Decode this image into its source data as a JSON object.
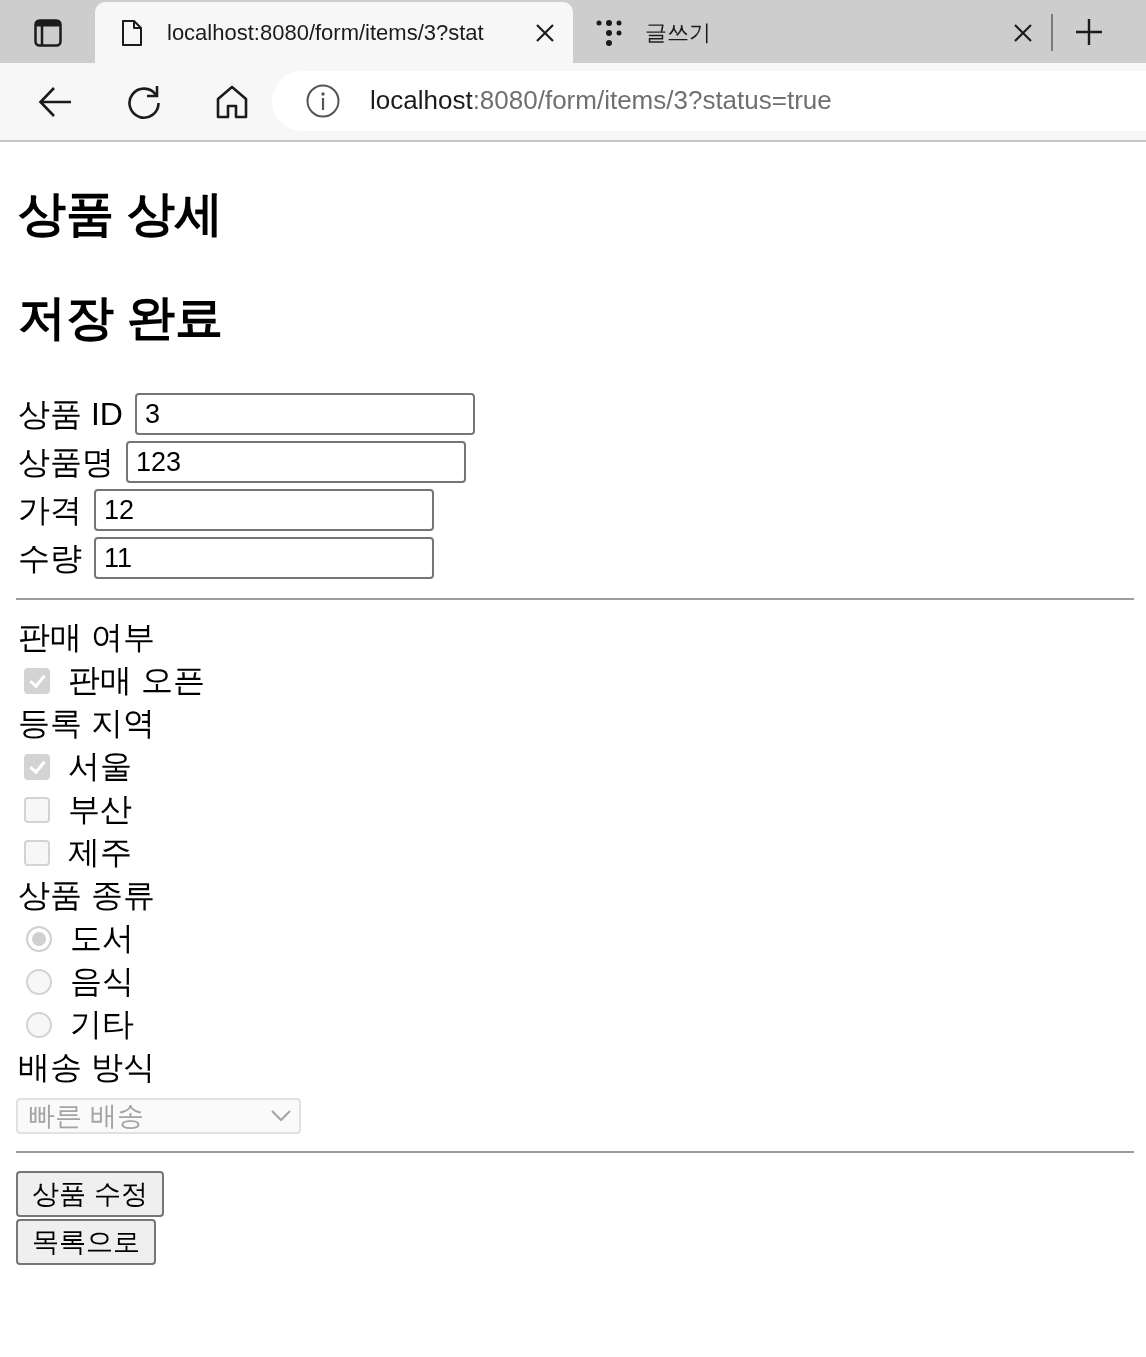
{
  "browser": {
    "tabs": [
      {
        "kind": "file",
        "title": "localhost:8080/form/items/3?stat",
        "selected": true
      },
      {
        "kind": "site",
        "title": "글쓰기",
        "selected": false
      }
    ],
    "address_bar": {
      "host": "localhost",
      "path": ":8080/form/items/3?status=true"
    }
  },
  "page": {
    "headings": [
      "상품 상세",
      "저장 완료"
    ],
    "fields": [
      {
        "label": "상품 ID",
        "value": "3"
      },
      {
        "label": "상품명",
        "value": "123"
      },
      {
        "label": "가격",
        "value": "12"
      },
      {
        "label": "수량",
        "value": "11"
      }
    ],
    "groups": [
      {
        "title": "판매 여부",
        "kind": "checkbox",
        "options": [
          {
            "label": "판매 오픈",
            "checked": true,
            "disabled": true
          }
        ]
      },
      {
        "title": "등록 지역",
        "kind": "checkbox",
        "options": [
          {
            "label": "서울",
            "checked": true,
            "disabled": true
          },
          {
            "label": "부산",
            "checked": false,
            "disabled": true
          },
          {
            "label": "제주",
            "checked": false,
            "disabled": true
          }
        ]
      },
      {
        "title": "상품 종류",
        "kind": "radio",
        "options": [
          {
            "label": "도서",
            "selected": true,
            "disabled": true
          },
          {
            "label": "음식",
            "selected": false,
            "disabled": true
          },
          {
            "label": "기타",
            "selected": false,
            "disabled": true
          }
        ]
      },
      {
        "title": "배송 방식",
        "kind": "select",
        "value": "빠른 배송",
        "disabled": true
      }
    ],
    "buttons": [
      "상품 수정",
      "목록으로"
    ]
  }
}
